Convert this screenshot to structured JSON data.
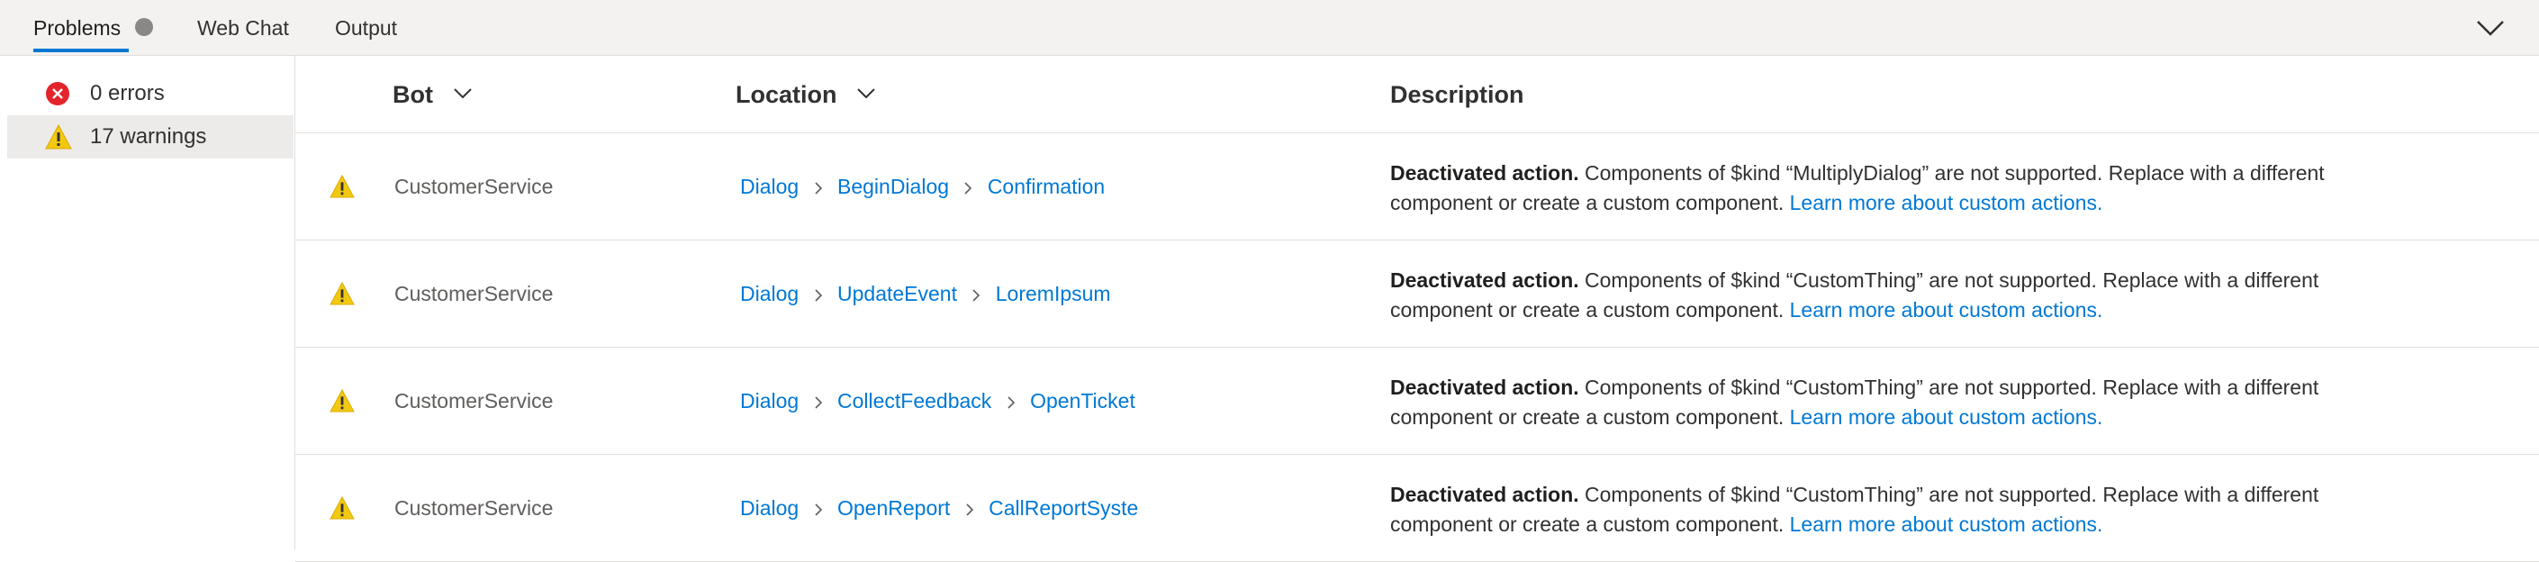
{
  "tabs": [
    {
      "label": "Problems"
    },
    {
      "label": "Web Chat"
    },
    {
      "label": "Output"
    }
  ],
  "sidebar": {
    "errors_label": "0 errors",
    "warnings_label": "17 warnings"
  },
  "table": {
    "headers": {
      "bot": "Bot",
      "location": "Location",
      "description": "Description"
    },
    "rows": [
      {
        "bot": "CustomerService",
        "location": [
          "Dialog",
          "BeginDialog",
          "Confirmation"
        ],
        "desc_title": "Deactivated action.",
        "desc_text": " Components of $kind “MultiplyDialog” are not supported. Replace with a different component or create a custom component. ",
        "desc_link": "Learn more about custom actions."
      },
      {
        "bot": "CustomerService",
        "location": [
          "Dialog",
          "UpdateEvent",
          "LoremIpsum"
        ],
        "desc_title": "Deactivated action.",
        "desc_text": " Components of $kind “CustomThing” are not supported. Replace with a different component or create a custom component. ",
        "desc_link": "Learn more about custom actions."
      },
      {
        "bot": "CustomerService",
        "location": [
          "Dialog",
          "CollectFeedback",
          "OpenTicket"
        ],
        "desc_title": "Deactivated action.",
        "desc_text": " Components of $kind “CustomThing” are not supported. Replace with a different component or create a custom component. ",
        "desc_link": "Learn more about custom actions."
      },
      {
        "bot": "CustomerService",
        "location": [
          "Dialog",
          "OpenReport",
          "CallReportSyste"
        ],
        "desc_title": "Deactivated action.",
        "desc_text": " Components of $kind “CustomThing” are not supported. Replace with a different component or create a custom component. ",
        "desc_link": "Learn more about custom actions."
      }
    ]
  },
  "colors": {
    "accent": "#0078d4",
    "error": "#e3242b",
    "warning": "#f2c811"
  },
  "icons": {
    "problems_status": "status-dot-icon",
    "collapse": "chevron-down-icon",
    "errors": "error-circle-icon",
    "warnings": "warning-triangle-icon",
    "sort": "chevron-down-icon",
    "location_separator": "chevron-right-icon"
  }
}
